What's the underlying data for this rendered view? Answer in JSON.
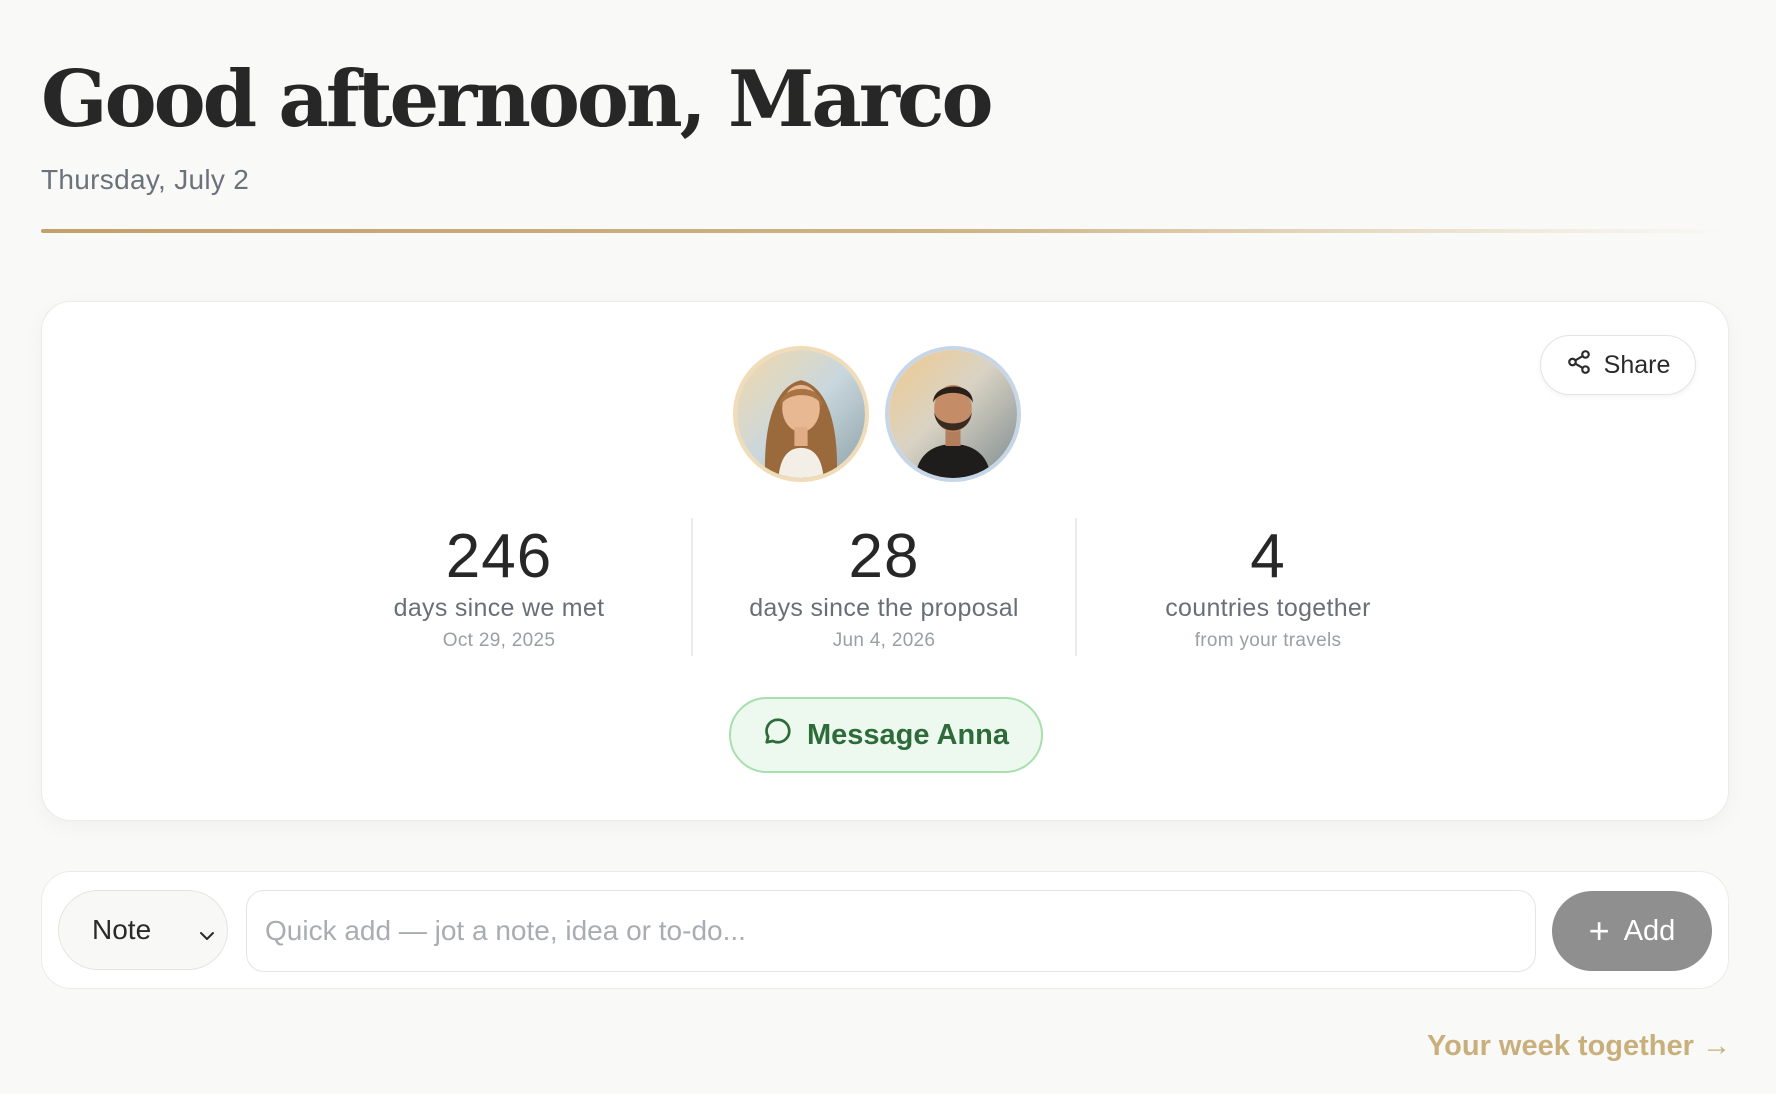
{
  "header": {
    "greeting": "Good afternoon, Marco",
    "date": "Thursday, July 2"
  },
  "card": {
    "share_label": "Share",
    "avatars": [
      {
        "name_icon": "partner-avatar",
        "border_color": "#f0dcb8"
      },
      {
        "name_icon": "user-avatar",
        "border_color": "#c7d6e6"
      }
    ],
    "stats": [
      {
        "value": "246",
        "label": "days since we met",
        "sub": "Oct 29, 2025"
      },
      {
        "value": "28",
        "label": "days since the proposal",
        "sub": "Jun 4, 2026"
      },
      {
        "value": "4",
        "label": "countries together",
        "sub": "from your travels"
      }
    ],
    "message_label": "Message Anna"
  },
  "quick_add": {
    "type_value": "Note",
    "placeholder": "Quick add — jot a note, idea or to-do...",
    "add_label": "Add"
  },
  "footer": {
    "week_link": "Your week together →"
  },
  "colors": {
    "accent_gold": "#c2a16c",
    "message_green": "#2e6b3a",
    "message_bg": "#edf9ee",
    "add_button": "#8f8f8f"
  }
}
